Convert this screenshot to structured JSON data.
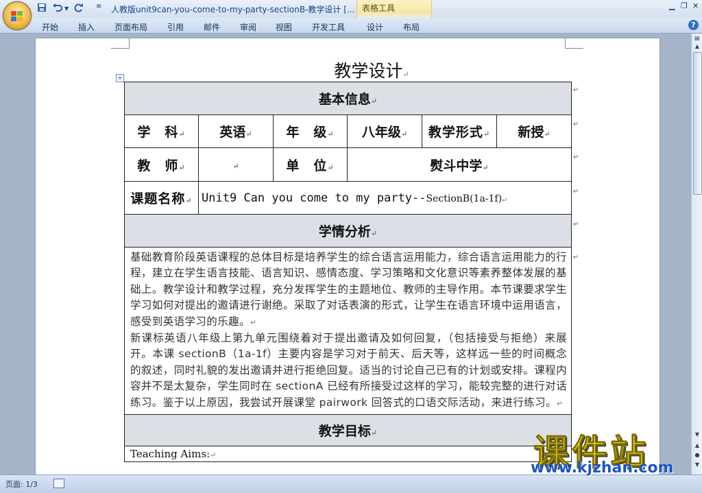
{
  "titlebar": {
    "title": "人教版unit9can-you-come-to-my-party-sectionB-教学设计 [...",
    "context_group": "表格工具",
    "qa_more": "≡"
  },
  "ribbon": {
    "tabs": [
      "开始",
      "插入",
      "页面布局",
      "引用",
      "邮件",
      "审阅",
      "视图",
      "开发工具",
      "设计",
      "布局"
    ],
    "help": "?"
  },
  "document": {
    "title": "教学设计",
    "para_mark": "↵",
    "table": {
      "basic_info_header": "基本信息",
      "subject_label": "学　科",
      "subject_value": "英语",
      "grade_label": "年　级",
      "grade_value": "八年级",
      "form_label": "教学形式",
      "form_value": "新授",
      "teacher_label": "教　师",
      "teacher_value": "",
      "unit_label": "单　位",
      "unit_value": "熨斗中学",
      "topic_label": "课题名称",
      "topic_value_main": "Unit9 Can you come to my party--",
      "topic_value_section": "SectionB(1a-1f)",
      "analysis_header": "学情分析",
      "analysis_p1": "基础教育阶段英语课程的总体目标是培养学生的综合语言运用能力，综合语言运用能力的行程，建立在学生语言技能、语言知识、感情态度、学习策略和文化意识等素养整体发展的基础上。教学设计和教学过程，充分发挥学生的主题地位、教师的主导作用。本节课要求学生学习如何对提出的邀请进行谢绝。采取了对话表演的形式，让学生在语言环境中运用语言，感受到英语学习的乐趣。",
      "analysis_p2": "新课标英语八年级上第九单元围绕着对于提出邀请及如何回复，（包括接受与拒绝）来展开。本课 sectionB（1a-1f）主要内容是学习对于前天、后天等，这样远一些的时间概念的叙述，同时礼貌的发出邀请并进行拒绝回复。适当的讨论自己已有的计划或安排。课程内容并不是太复杂，学生同时在 sectionA 已经有所接受过这样的学习，能较完整的进行对话练习。鉴于以上原因，我尝试开展课堂 pairwork 回答式的口语交际活动，来进行练习。",
      "aims_header": "教学目标",
      "aims_line": "Teaching Aims:"
    }
  },
  "status": {
    "page": "页面: 1/3"
  },
  "watermark": {
    "main": "课件站",
    "url": "www.kjzhan.com"
  },
  "colors": {
    "header_fill": "#dcdfe6",
    "ribbon": "#c7d8ed",
    "watermark_yellow": "#f7e11a",
    "watermark_blue": "#1b56c9"
  }
}
